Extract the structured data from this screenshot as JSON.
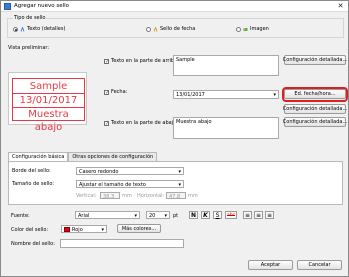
{
  "window": {
    "title": "Agregar nuevo sello",
    "close_glyph": "✕"
  },
  "seal_type": {
    "legend": "Tipo de sello",
    "options": [
      {
        "label": "Texto (detalles)",
        "selected": true
      },
      {
        "label": "Sello de fecha",
        "selected": false
      },
      {
        "label": "Imagen",
        "selected": false
      }
    ]
  },
  "preview": {
    "label": "Vista preliminar:",
    "top": "Sample",
    "middle": "13/01/2017",
    "bottom": "Muestra abajo",
    "color": "#e63946"
  },
  "top_text": {
    "label": "Texto en la parte de arriba:",
    "value": "Sample",
    "button": "Configuración detallada..."
  },
  "date": {
    "label": "Fecha:",
    "value": "13/01/2017",
    "format_button": "Ed. fecha/hora...",
    "detail_button": "Configuración detallada..."
  },
  "bottom_text": {
    "label": "Texto en la parte de abajo:",
    "value": "Muestra abajo",
    "button": "Configuración detallada..."
  },
  "tabs": [
    "Configuración básica",
    "Otras opciones de configuración"
  ],
  "basic": {
    "border_label": "Borde del sello:",
    "border_value": "Casero redondo",
    "size_label": "Tamaño de sello:",
    "size_value": "Ajustar el tamaño de texto",
    "vertical_label": "Vertical:",
    "vertical_value": "38.3",
    "horizontal_label": "Horizontal:",
    "horizontal_value": "47.8",
    "unit": "mm",
    "font_label": "Fuente:",
    "font_value": "Arial",
    "font_size": "20",
    "font_size_unit": "pt",
    "bold": "N",
    "italic": "K",
    "underline": "S",
    "strike": "abc",
    "color_label": "Color del sello:",
    "color_value": "Rojo",
    "more_colors": "Más colores..."
  },
  "name_label": "Nombre del sello:",
  "name_value": "",
  "accept": "Aceptar",
  "cancel": "Cancelar"
}
